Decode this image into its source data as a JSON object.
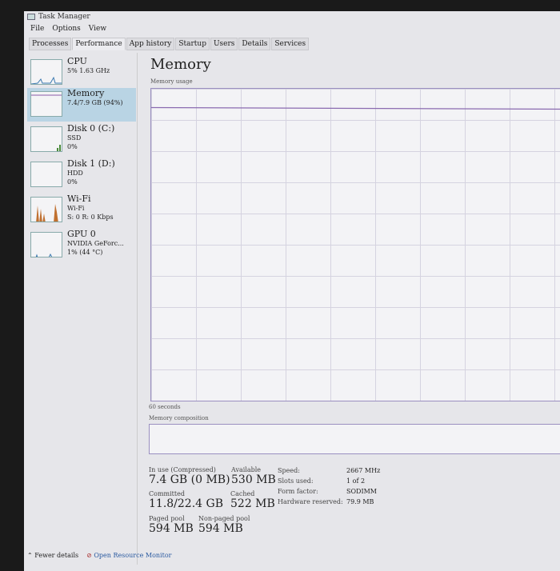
{
  "window": {
    "title": "Task Manager"
  },
  "menu": [
    "File",
    "Options",
    "View"
  ],
  "tabs": [
    "Processes",
    "Performance",
    "App history",
    "Startup",
    "Users",
    "Details",
    "Services"
  ],
  "sidebar": [
    {
      "name": "CPU",
      "l1": "5% 1.63 GHz",
      "l2": ""
    },
    {
      "name": "Memory",
      "l1": "7.4/7.9 GB (94%)",
      "l2": ""
    },
    {
      "name": "Disk 0 (C:)",
      "l1": "SSD",
      "l2": "0%"
    },
    {
      "name": "Disk 1 (D:)",
      "l1": "HDD",
      "l2": "0%"
    },
    {
      "name": "Wi-Fi",
      "l1": "Wi-Fi",
      "l2": "S: 0 R: 0 Kbps"
    },
    {
      "name": "GPU 0",
      "l1": "NVIDIA GeForc...",
      "l2": "1% (44 °C)"
    }
  ],
  "main": {
    "title": "Memory",
    "usage_label": "Memory usage",
    "time_label": "60 seconds",
    "composition_label": "Memory composition",
    "usage_percent": 94,
    "stats": {
      "in_use_label": "In use (Compressed)",
      "in_use": "7.4 GB (0 MB)",
      "available_label": "Available",
      "available": "530 MB",
      "committed_label": "Committed",
      "committed": "11.8/22.4 GB",
      "cached_label": "Cached",
      "cached": "522 MB",
      "paged_label": "Paged pool",
      "paged": "594 MB",
      "nonpaged_label": "Non-paged pool",
      "nonpaged": "594 MB",
      "speed_label": "Speed:",
      "speed": "2667 MHz",
      "slots_label": "Slots used:",
      "slots": "1 of 2",
      "form_label": "Form factor:",
      "form": "SODIMM",
      "hw_label": "Hardware reserved:",
      "hw": "79.9 MB"
    }
  },
  "footer": {
    "fewer": "Fewer details",
    "monitor": "Open Resource Monitor"
  }
}
